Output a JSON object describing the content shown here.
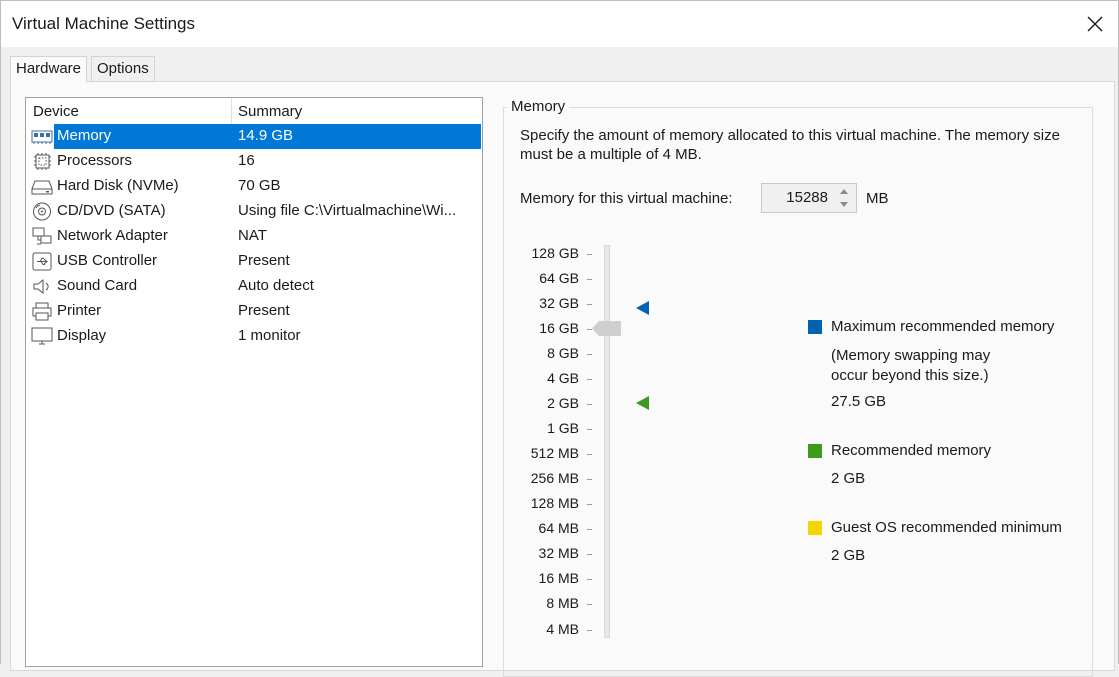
{
  "window": {
    "title": "Virtual Machine Settings"
  },
  "tabs": [
    {
      "label": "Hardware",
      "active": true
    },
    {
      "label": "Options",
      "active": false
    }
  ],
  "device_list": {
    "headers": {
      "device": "Device",
      "summary": "Summary"
    },
    "rows": [
      {
        "icon": "memory-icon",
        "name": "Memory",
        "summary": "14.9 GB",
        "selected": true
      },
      {
        "icon": "processor-icon",
        "name": "Processors",
        "summary": "16"
      },
      {
        "icon": "hard-disk-icon",
        "name": "Hard Disk (NVMe)",
        "summary": "70 GB"
      },
      {
        "icon": "cd-dvd-icon",
        "name": "CD/DVD (SATA)",
        "summary": "Using file C:\\Virtualmachine\\Wi..."
      },
      {
        "icon": "network-adapter-icon",
        "name": "Network Adapter",
        "summary": "NAT"
      },
      {
        "icon": "usb-icon",
        "name": "USB Controller",
        "summary": "Present"
      },
      {
        "icon": "speaker-icon",
        "name": "Sound Card",
        "summary": "Auto detect"
      },
      {
        "icon": "printer-icon",
        "name": "Printer",
        "summary": "Present"
      },
      {
        "icon": "monitor-icon",
        "name": "Display",
        "summary": "1 monitor"
      }
    ]
  },
  "memory": {
    "group_label": "Memory",
    "description": "Specify the amount of memory allocated to this virtual machine. The memory size must be a multiple of 4 MB.",
    "field_label": "Memory for this virtual machine:",
    "value": "15288",
    "unit": "MB",
    "scale": [
      "128 GB",
      "64 GB",
      "32 GB",
      "16 GB",
      "8 GB",
      "4 GB",
      "2 GB",
      "1 GB",
      "512 MB",
      "256 MB",
      "128 MB",
      "64 MB",
      "32 MB",
      "16 MB",
      "8 MB",
      "4 MB"
    ],
    "legend": {
      "max": {
        "label": "Maximum recommended memory",
        "note": "(Memory swapping may occur beyond this size.)",
        "value": "27.5 GB",
        "color": "#0063b1"
      },
      "recommended": {
        "label": "Recommended memory",
        "value": "2 GB",
        "color": "#3c9a1e"
      },
      "guest_min": {
        "label": "Guest OS recommended minimum",
        "value": "2 GB",
        "color": "#f2d600"
      }
    }
  }
}
